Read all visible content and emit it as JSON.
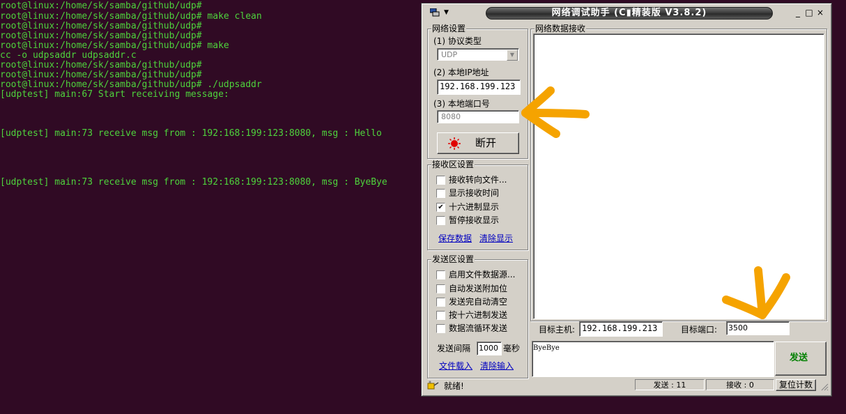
{
  "terminal": {
    "lines": [
      "root@linux:/home/sk/samba/github/udp#",
      "root@linux:/home/sk/samba/github/udp# make clean",
      "root@linux:/home/sk/samba/github/udp#",
      "root@linux:/home/sk/samba/github/udp#",
      "root@linux:/home/sk/samba/github/udp# make",
      "cc -o udpsaddr udpsaddr.c",
      "root@linux:/home/sk/samba/github/udp#",
      "root@linux:/home/sk/samba/github/udp#",
      "root@linux:/home/sk/samba/github/udp# ./udpsaddr",
      "[udptest] main:67 Start receiving message:",
      "[udptest] main:73 receive msg from : 192:168:199:123:8080, msg : Hello",
      "[udptest] main:73 receive msg from : 192:168:199:123:8080, msg : ByeBye"
    ]
  },
  "window": {
    "title": "网络调试助手 (C▮精装版 V3.8.2)",
    "minimize": "_",
    "maximize": "□",
    "close": "×"
  },
  "net_settings": {
    "title": "网络设置",
    "protocol_label": "(1) 协议类型",
    "protocol_value": "UDP",
    "ip_label": "(2) 本地IP地址",
    "ip_value": "192.168.199.123",
    "port_label": "(3) 本地端口号",
    "port_value": "8080",
    "disconnect_label": "断开"
  },
  "recv_settings": {
    "title": "接收区设置",
    "options": [
      {
        "label": "接收转向文件...",
        "checked": false
      },
      {
        "label": "显示接收时间",
        "checked": false
      },
      {
        "label": "十六进制显示",
        "checked": true
      },
      {
        "label": "暂停接收显示",
        "checked": false
      }
    ],
    "save_link": "保存数据",
    "clear_link": "清除显示"
  },
  "send_settings": {
    "title": "发送区设置",
    "options": [
      {
        "label": "启用文件数据源...",
        "checked": false
      },
      {
        "label": "自动发送附加位",
        "checked": false
      },
      {
        "label": "发送完自动清空",
        "checked": false
      },
      {
        "label": "按十六进制发送",
        "checked": false
      },
      {
        "label": "数据流循环发送",
        "checked": false
      }
    ],
    "interval_label": "发送间隔",
    "interval_value": "1000",
    "interval_unit": "毫秒",
    "load_file_link": "文件载入",
    "clear_input_link": "清除输入"
  },
  "recv_area": {
    "title": "网络数据接收"
  },
  "target": {
    "host_label": "目标主机:",
    "host_value": "192.168.199.213",
    "port_label": "目标端口:",
    "port_value": "3500"
  },
  "send_area": {
    "text": "ByeBye",
    "send_button": "发送"
  },
  "status": {
    "ready": "就绪!",
    "sent": "发送 : 11",
    "received": "接收 : 0",
    "reset": "复位计数"
  },
  "colors": {
    "terminal_bg": "#300a24",
    "terminal_text": "#4ed33c",
    "annotation_arrow": "#f5a300",
    "link": "#0000c0",
    "send_button_text": "#008000"
  }
}
